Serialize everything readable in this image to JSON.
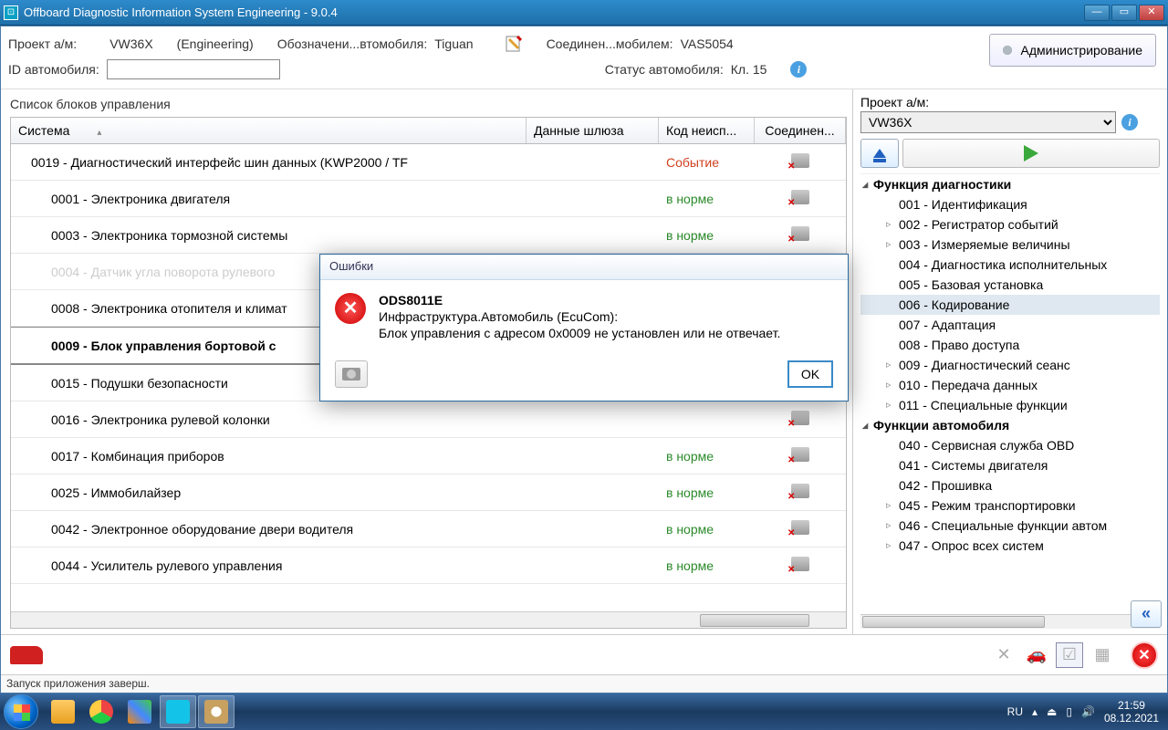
{
  "window": {
    "title": "Offboard Diagnostic Information System Engineering - 9.0.4",
    "minimize": "—",
    "maximize": "▭",
    "close": "✕"
  },
  "header": {
    "project_label": "Проект а/м:",
    "project_value": "VW36X",
    "engineering": "(Engineering)",
    "vehicle_desig_label": "Обозначени...втомобиля:",
    "vehicle_desig_value": "Tiguan",
    "connection_label": "Соединен...мобилем:",
    "connection_value": "VAS5054",
    "vehicle_id_label": "ID автомобиля:",
    "vehicle_status_label": "Статус автомобиля:",
    "vehicle_status_value": "Кл. 15",
    "admin_button": "Администрирование"
  },
  "left": {
    "title": "Список блоков управления",
    "columns": {
      "system": "Система",
      "gateway": "Данные шлюза",
      "fault": "Код неисп...",
      "conn": "Соединен..."
    },
    "codes": {
      "ok": "в норме",
      "event": "Событие"
    },
    "rows": [
      {
        "sys": "0019 - Диагностический интерфейс шин данных  (KWP2000 / TF",
        "code": "event",
        "parent": true
      },
      {
        "sys": "0001 - Электроника двигателя",
        "code": "ok"
      },
      {
        "sys": "0003 - Электроника тормозной системы",
        "code": "ok"
      },
      {
        "sys": "0004 - Датчик угла поворота рулевого",
        "disabled": true
      },
      {
        "sys": "0008 - Электроника отопителя и климат",
        "code": ""
      },
      {
        "sys": "0009 - Блок управления бортовой с",
        "selected": true
      },
      {
        "sys": "0015 - Подушки безопасности"
      },
      {
        "sys": "0016 - Электроника рулевой колонки"
      },
      {
        "sys": "0017 - Комбинация приборов",
        "code": "ok"
      },
      {
        "sys": "0025 - Иммобилайзер",
        "code": "ok"
      },
      {
        "sys": "0042 - Электронное оборудование двери водителя",
        "code": "ok"
      },
      {
        "sys": "0044 - Усилитель рулевого управления",
        "code": "ok"
      }
    ]
  },
  "right": {
    "project_label": "Проект а/м:",
    "project_value": "VW36X",
    "groups": [
      {
        "label": "Функция диагностики",
        "items": [
          {
            "label": "001 - Идентификация"
          },
          {
            "label": "002 - Регистратор событий",
            "arrow": true
          },
          {
            "label": "003 - Измеряемые величины",
            "arrow": true
          },
          {
            "label": "004 - Диагностика исполнительных"
          },
          {
            "label": "005 - Базовая установка"
          },
          {
            "label": "006 - Кодирование",
            "selected": true
          },
          {
            "label": "007 - Адаптация"
          },
          {
            "label": "008 - Право доступа"
          },
          {
            "label": "009 - Диагностический сеанс",
            "arrow": true
          },
          {
            "label": "010 - Передача данных",
            "arrow": true
          },
          {
            "label": "011 - Специальные функции",
            "arrow": true
          }
        ]
      },
      {
        "label": "Функции автомобиля",
        "items": [
          {
            "label": "040 - Сервисная служба OBD"
          },
          {
            "label": "041 - Системы двигателя"
          },
          {
            "label": "042 - Прошивка"
          },
          {
            "label": "045 - Режим транспортировки",
            "arrow": true
          },
          {
            "label": "046 - Специальные функции автом",
            "arrow": true
          },
          {
            "label": "047 - Опрос всех систем",
            "arrow": true
          }
        ]
      }
    ]
  },
  "dialog": {
    "title": "Ошибки",
    "code": "ODS8011E",
    "line1": "Инфраструктура.Автомобиль (EcuCom):",
    "line2": "Блок управления с адресом 0x0009 не установлен или не отвечает.",
    "ok": "OK"
  },
  "status": "Запуск приложения заверш.",
  "taskbar": {
    "lang": "RU",
    "time": "21:59",
    "date": "08.12.2021"
  }
}
